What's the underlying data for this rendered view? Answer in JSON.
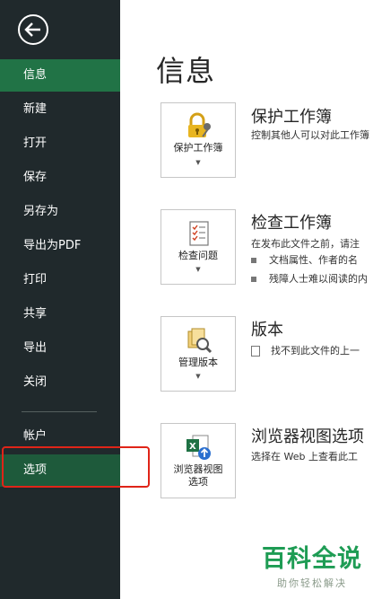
{
  "sidebar": {
    "items": [
      {
        "label": "信息"
      },
      {
        "label": "新建"
      },
      {
        "label": "打开"
      },
      {
        "label": "保存"
      },
      {
        "label": "另存为"
      },
      {
        "label": "导出为PDF"
      },
      {
        "label": "打印"
      },
      {
        "label": "共享"
      },
      {
        "label": "导出"
      },
      {
        "label": "关闭"
      }
    ],
    "account": "帐户",
    "options": "选项"
  },
  "main": {
    "title": "信息",
    "sections": [
      {
        "button": "保护工作簿",
        "title": "保护工作簿",
        "desc": "控制其他人可以对此工作簿"
      },
      {
        "button": "检查问题",
        "title": "检查工作簿",
        "desc": "在发布此文件之前，请注",
        "bullets": [
          "文档属性、作者的名",
          "残障人士难以阅读的内"
        ]
      },
      {
        "button": "管理版本",
        "title": "版本",
        "desc": "找不到此文件的上一"
      },
      {
        "button": "浏览器视图",
        "button2": "选项",
        "title": "浏览器视图选项",
        "desc": "选择在 Web 上查看此工"
      }
    ]
  },
  "watermark": {
    "title": "百科全说",
    "subtitle": "助你轻松解决"
  },
  "colors": {
    "sidebar_bg": "#20292c",
    "active_bg": "#217346",
    "highlight": "#e02418",
    "watermark": "#1e9c54"
  }
}
